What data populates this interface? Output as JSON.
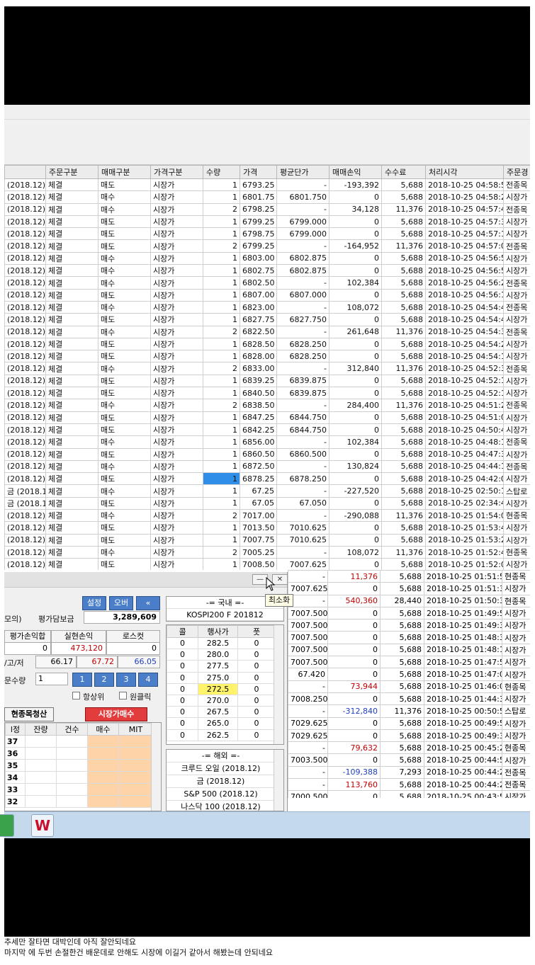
{
  "grid": {
    "columns": [
      "주문구분",
      "매매구분",
      "가격구분",
      "수량",
      "가격",
      "평균단가",
      "매매손익",
      "수수료",
      "처리시각",
      "주문경"
    ],
    "rows": [
      {
        "c0": "(2018.12)",
        "c1": "체결",
        "c2": "매도",
        "c3": "시장가",
        "c4": "1",
        "c5": "6793.25",
        "c6": "-",
        "c7": "-193,392",
        "c8": "5,688",
        "c9": "2018-10-25 04:58:51",
        "c10": "전종목"
      },
      {
        "c0": "(2018.12)",
        "c1": "체결",
        "c2": "매수",
        "c3": "시장가",
        "c4": "1",
        "c5": "6801.75",
        "c6": "6801.750",
        "c7": "0",
        "c8": "5,688",
        "c9": "2018-10-25 04:58:20",
        "c10": "시장가"
      },
      {
        "c0": "(2018.12)",
        "c1": "체결",
        "c2": "매수",
        "c3": "시장가",
        "c4": "2",
        "c5": "6798.25",
        "c6": "-",
        "c7": "34,128",
        "c8": "11,376",
        "c9": "2018-10-25 04:57:48",
        "c10": "전종목"
      },
      {
        "c0": "(2018.12)",
        "c1": "체결",
        "c2": "매도",
        "c3": "시장가",
        "c4": "1",
        "c5": "6799.25",
        "c6": "6799.000",
        "c7": "0",
        "c8": "5,688",
        "c9": "2018-10-25 04:57:37",
        "c10": "시장가"
      },
      {
        "c0": "(2018.12)",
        "c1": "체결",
        "c2": "매도",
        "c3": "시장가",
        "c4": "1",
        "c5": "6798.75",
        "c6": "6799.000",
        "c7": "0",
        "c8": "5,688",
        "c9": "2018-10-25 04:57:17",
        "c10": "시장가"
      },
      {
        "c0": "(2018.12)",
        "c1": "체결",
        "c2": "매도",
        "c3": "시장가",
        "c4": "2",
        "c5": "6799.25",
        "c6": "-",
        "c7": "-164,952",
        "c8": "11,376",
        "c9": "2018-10-25 04:57:01",
        "c10": "전종목"
      },
      {
        "c0": "(2018.12)",
        "c1": "체결",
        "c2": "매수",
        "c3": "시장가",
        "c4": "1",
        "c5": "6803.00",
        "c6": "6802.875",
        "c7": "0",
        "c8": "5,688",
        "c9": "2018-10-25 04:56:53",
        "c10": "시장가"
      },
      {
        "c0": "(2018.12)",
        "c1": "체결",
        "c2": "매수",
        "c3": "시장가",
        "c4": "1",
        "c5": "6802.75",
        "c6": "6802.875",
        "c7": "0",
        "c8": "5,688",
        "c9": "2018-10-25 04:56:53",
        "c10": "시장가"
      },
      {
        "c0": "(2018.12)",
        "c1": "체결",
        "c2": "매수",
        "c3": "시장가",
        "c4": "1",
        "c5": "6802.50",
        "c6": "-",
        "c7": "102,384",
        "c8": "5,688",
        "c9": "2018-10-25 04:56:29",
        "c10": "전종목"
      },
      {
        "c0": "(2018.12)",
        "c1": "체결",
        "c2": "매도",
        "c3": "시장가",
        "c4": "1",
        "c5": "6807.00",
        "c6": "6807.000",
        "c7": "0",
        "c8": "5,688",
        "c9": "2018-10-25 04:56:19",
        "c10": "시장가"
      },
      {
        "c0": "(2018.12)",
        "c1": "체결",
        "c2": "매수",
        "c3": "시장가",
        "c4": "1",
        "c5": "6823.00",
        "c6": "-",
        "c7": "108,072",
        "c8": "5,688",
        "c9": "2018-10-25 04:54:49",
        "c10": "전종목"
      },
      {
        "c0": "(2018.12)",
        "c1": "체결",
        "c2": "매도",
        "c3": "시장가",
        "c4": "1",
        "c5": "6827.75",
        "c6": "6827.750",
        "c7": "0",
        "c8": "5,688",
        "c9": "2018-10-25 04:54:44",
        "c10": "시장가"
      },
      {
        "c0": "(2018.12)",
        "c1": "체결",
        "c2": "매수",
        "c3": "시장가",
        "c4": "2",
        "c5": "6822.50",
        "c6": "-",
        "c7": "261,648",
        "c8": "11,376",
        "c9": "2018-10-25 04:54:35",
        "c10": "전종목"
      },
      {
        "c0": "(2018.12)",
        "c1": "체결",
        "c2": "매도",
        "c3": "시장가",
        "c4": "1",
        "c5": "6828.50",
        "c6": "6828.250",
        "c7": "0",
        "c8": "5,688",
        "c9": "2018-10-25 04:54:27",
        "c10": "시장가"
      },
      {
        "c0": "(2018.12)",
        "c1": "체결",
        "c2": "매도",
        "c3": "시장가",
        "c4": "1",
        "c5": "6828.00",
        "c6": "6828.250",
        "c7": "0",
        "c8": "5,688",
        "c9": "2018-10-25 04:54:17",
        "c10": "시장가"
      },
      {
        "c0": "(2018.12)",
        "c1": "체결",
        "c2": "매수",
        "c3": "시장가",
        "c4": "2",
        "c5": "6833.00",
        "c6": "-",
        "c7": "312,840",
        "c8": "11,376",
        "c9": "2018-10-25 04:52:33",
        "c10": "전종목"
      },
      {
        "c0": "(2018.12)",
        "c1": "체결",
        "c2": "매도",
        "c3": "시장가",
        "c4": "1",
        "c5": "6839.25",
        "c6": "6839.875",
        "c7": "0",
        "c8": "5,688",
        "c9": "2018-10-25 04:52:16",
        "c10": "시장가"
      },
      {
        "c0": "(2018.12)",
        "c1": "체결",
        "c2": "매도",
        "c3": "시장가",
        "c4": "1",
        "c5": "6840.50",
        "c6": "6839.875",
        "c7": "0",
        "c8": "5,688",
        "c9": "2018-10-25 04:52:12",
        "c10": "시장가"
      },
      {
        "c0": "(2018.12)",
        "c1": "체결",
        "c2": "매수",
        "c3": "시장가",
        "c4": "2",
        "c5": "6838.50",
        "c6": "-",
        "c7": "284,400",
        "c8": "11,376",
        "c9": "2018-10-25 04:51:20",
        "c10": "전종목"
      },
      {
        "c0": "(2018.12)",
        "c1": "체결",
        "c2": "매도",
        "c3": "시장가",
        "c4": "1",
        "c5": "6847.25",
        "c6": "6844.750",
        "c7": "0",
        "c8": "5,688",
        "c9": "2018-10-25 04:51:04",
        "c10": "시장가"
      },
      {
        "c0": "(2018.12)",
        "c1": "체결",
        "c2": "매도",
        "c3": "시장가",
        "c4": "1",
        "c5": "6842.25",
        "c6": "6844.750",
        "c7": "0",
        "c8": "5,688",
        "c9": "2018-10-25 04:50:43",
        "c10": "시장가"
      },
      {
        "c0": "(2018.12)",
        "c1": "체결",
        "c2": "매수",
        "c3": "시장가",
        "c4": "1",
        "c5": "6856.00",
        "c6": "-",
        "c7": "102,384",
        "c8": "5,688",
        "c9": "2018-10-25 04:48:16",
        "c10": "전종목"
      },
      {
        "c0": "(2018.12)",
        "c1": "체결",
        "c2": "매도",
        "c3": "시장가",
        "c4": "1",
        "c5": "6860.50",
        "c6": "6860.500",
        "c7": "0",
        "c8": "5,688",
        "c9": "2018-10-25 04:47:35",
        "c10": "시장가"
      },
      {
        "c0": "(2018.12)",
        "c1": "체결",
        "c2": "매수",
        "c3": "시장가",
        "c4": "1",
        "c5": "6872.50",
        "c6": "-",
        "c7": "130,824",
        "c8": "5,688",
        "c9": "2018-10-25 04:44:11",
        "c10": "전종목"
      },
      {
        "c0": "(2018.12)",
        "c1": "체결",
        "c2": "매도",
        "c3": "시장가",
        "c4": "1",
        "c5": "6878.25",
        "c6": "6878.250",
        "c7": "0",
        "c8": "5,688",
        "c9": "2018-10-25 04:42:05",
        "c10": "시장가"
      },
      {
        "c0": "금 (2018.12)",
        "c1": "체결",
        "c2": "매수",
        "c3": "시장가",
        "c4": "1",
        "c5": "67.25",
        "c6": "-",
        "c7": "-227,520",
        "c8": "5,688",
        "c9": "2018-10-25 02:50:14",
        "c10": "스탑로"
      },
      {
        "c0": "금 (2018.12)",
        "c1": "체결",
        "c2": "매도",
        "c3": "시장가",
        "c4": "1",
        "c5": "67.05",
        "c6": "67.050",
        "c7": "0",
        "c8": "5,688",
        "c9": "2018-10-25 02:34:45",
        "c10": "시장가"
      },
      {
        "c0": "(2018.12)",
        "c1": "체결",
        "c2": "매수",
        "c3": "시장가",
        "c4": "2",
        "c5": "7017.00",
        "c6": "-",
        "c7": "-290,088",
        "c8": "11,376",
        "c9": "2018-10-25 01:54:09",
        "c10": "현종목"
      },
      {
        "c0": "(2018.12)",
        "c1": "체결",
        "c2": "매도",
        "c3": "시장가",
        "c4": "1",
        "c5": "7013.50",
        "c6": "7010.625",
        "c7": "0",
        "c8": "5,688",
        "c9": "2018-10-25 01:53:46",
        "c10": "시장가"
      },
      {
        "c0": "(2018.12)",
        "c1": "체결",
        "c2": "매도",
        "c3": "시장가",
        "c4": "1",
        "c5": "7007.75",
        "c6": "7010.625",
        "c7": "0",
        "c8": "5,688",
        "c9": "2018-10-25 01:53:25",
        "c10": "시장가"
      },
      {
        "c0": "(2018.12)",
        "c1": "체결",
        "c2": "매수",
        "c3": "시장가",
        "c4": "2",
        "c5": "7005.25",
        "c6": "-",
        "c7": "108,072",
        "c8": "11,376",
        "c9": "2018-10-25 01:52:46",
        "c10": "현종목"
      },
      {
        "c0": "(2018.12)",
        "c1": "체결",
        "c2": "매도",
        "c3": "시장가",
        "c4": "1",
        "c5": "7008.50",
        "c6": "7007.625",
        "c7": "0",
        "c8": "5,688",
        "c9": "2018-10-25 01:52:08",
        "c10": "시장가"
      }
    ]
  },
  "grid2": {
    "rows": [
      {
        "c6": "-",
        "c7": "11,376",
        "c8": "5,688",
        "c9": "2018-10-25 01:51:58",
        "c10": "현종목"
      },
      {
        "c6": "7007.625",
        "c7": "0",
        "c8": "5,688",
        "c9": "2018-10-25 01:51:39",
        "c10": "시장가"
      },
      {
        "c6": "-",
        "c7": "540,360",
        "c8": "28,440",
        "c9": "2018-10-25 01:50:30",
        "c10": "현종목"
      },
      {
        "c6": "7007.500",
        "c7": "0",
        "c8": "5,688",
        "c9": "2018-10-25 01:49:56",
        "c10": "시장가"
      },
      {
        "c6": "7007.500",
        "c7": "0",
        "c8": "5,688",
        "c9": "2018-10-25 01:49:39",
        "c10": "시장가"
      },
      {
        "c6": "7007.500",
        "c7": "0",
        "c8": "5,688",
        "c9": "2018-10-25 01:48:37",
        "c10": "시장가"
      },
      {
        "c6": "7007.500",
        "c7": "0",
        "c8": "5,688",
        "c9": "2018-10-25 01:48:16",
        "c10": "시장가"
      },
      {
        "c6": "7007.500",
        "c7": "0",
        "c8": "5,688",
        "c9": "2018-10-25 01:47:57",
        "c10": "시장가"
      },
      {
        "c6": "67.420",
        "c7": "0",
        "c8": "5,688",
        "c9": "2018-10-25 01:47:07",
        "c10": "시장가"
      },
      {
        "c6": "-",
        "c7": "73,944",
        "c8": "5,688",
        "c9": "2018-10-25 01:46:05",
        "c10": "현종목"
      },
      {
        "c6": "7008.250",
        "c7": "0",
        "c8": "5,688",
        "c9": "2018-10-25 01:44:37",
        "c10": "시장가"
      },
      {
        "c6": "-",
        "c7": "-312,840",
        "c8": "11,376",
        "c9": "2018-10-25 00:50:51",
        "c10": "스탑로"
      },
      {
        "c6": "7029.625",
        "c7": "0",
        "c8": "5,688",
        "c9": "2018-10-25 00:49:58",
        "c10": "시장가"
      },
      {
        "c6": "7029.625",
        "c7": "0",
        "c8": "5,688",
        "c9": "2018-10-25 00:49:30",
        "c10": "시장가"
      },
      {
        "c6": "-",
        "c7": "79,632",
        "c8": "5,688",
        "c9": "2018-10-25 00:45:20",
        "c10": "현종목"
      },
      {
        "c6": "7003.500",
        "c7": "0",
        "c8": "5,688",
        "c9": "2018-10-25 00:44:57",
        "c10": "시장가"
      },
      {
        "c6": "-",
        "c7": "-109,388",
        "c8": "7,293",
        "c9": "2018-10-25 00:44:26",
        "c10": "전종목"
      },
      {
        "c6": "-",
        "c7": "113,760",
        "c8": "5,688",
        "c9": "2018-10-25 00:44:26",
        "c10": "전종목"
      },
      {
        "c6": "7000.500",
        "c7": "0",
        "c8": "5,688",
        "c9": "2018-10-25 00:43:57",
        "c10": "시장가"
      }
    ]
  },
  "panel": {
    "minimize_label": "—",
    "close_label": "✕",
    "tooltip": "최소화",
    "settings_btn": "설정",
    "ob_btn": "오버",
    "collapse_btn": "«",
    "mode_label": "모의)",
    "eval_margin_label": "평가담보금",
    "eval_margin_value": "3,289,609",
    "eval_pnl_label": "평가손익합",
    "realized_label": "실현손익",
    "losscut_label": "로스컷",
    "eval_pnl_value": "0",
    "realized_value": "473,120",
    "losscut_value": "0",
    "hlow_label": "/고/저",
    "h1": "66.17",
    "h2": "67.72",
    "h3": "66.05",
    "qty_label": "문수량",
    "qty_value": "1",
    "qty_presets": [
      "1",
      "2",
      "3",
      "4"
    ],
    "check_up": "항상위",
    "check_oneclick": "원클릭",
    "liquidate_btn": "현종목청산",
    "market_buy_btn": "시장가매수"
  },
  "domestic": {
    "title": "-= 국내 =-",
    "instrument": "KOSPI200 F 201812"
  },
  "options": {
    "headers": [
      "콜",
      "행사가",
      "풋"
    ],
    "rows": [
      {
        "call": "0",
        "strike": "282.5",
        "put": "0"
      },
      {
        "call": "0",
        "strike": "280.0",
        "put": "0"
      },
      {
        "call": "0",
        "strike": "277.5",
        "put": "0"
      },
      {
        "call": "0",
        "strike": "275.0",
        "put": "0"
      },
      {
        "call": "0",
        "strike": "272.5",
        "put": "0"
      },
      {
        "call": "0",
        "strike": "270.0",
        "put": "0"
      },
      {
        "call": "0",
        "strike": "267.5",
        "put": "0"
      },
      {
        "call": "0",
        "strike": "265.0",
        "put": "0"
      },
      {
        "call": "0",
        "strike": "262.5",
        "put": "0"
      }
    ]
  },
  "overseas": {
    "title": "-= 해외 =-",
    "items": [
      "크루드 오일 (2018.12)",
      "금 (2018.12)",
      "S&P 500 (2018.12)",
      "나스닥 100 (2018.12)"
    ]
  },
  "hoga": {
    "headers": [
      "l정",
      "잔량",
      "건수",
      "매수",
      "MIT"
    ],
    "prices": [
      "37",
      "36",
      "35",
      "34",
      "33",
      "32"
    ]
  },
  "taskbar": {
    "app_letter": "W"
  },
  "captions": {
    "line1": "추세만 잘타면 대박인데 아직 잘안되네요",
    "line2": "마지막 에 두번 손절한건 배운데로 안해도 시장에 이길거 같아서 해봤는데 안되네요"
  }
}
